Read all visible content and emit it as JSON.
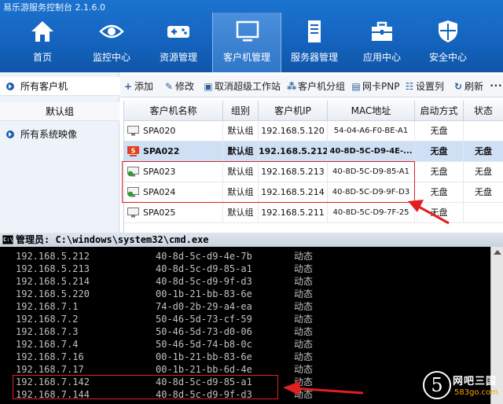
{
  "app": {
    "title": "易乐游服务控制台 2.1.6.0"
  },
  "nav": [
    {
      "label": "首页",
      "icon": "home-icon"
    },
    {
      "label": "监控中心",
      "icon": "eye-icon"
    },
    {
      "label": "资源管理",
      "icon": "gamepad-icon"
    },
    {
      "label": "客户机管理",
      "icon": "monitor-icon"
    },
    {
      "label": "服务器管理",
      "icon": "server-icon"
    },
    {
      "label": "应用中心",
      "icon": "toolbox-icon"
    },
    {
      "label": "安全中心",
      "icon": "shield-icon"
    }
  ],
  "sidebar": {
    "items": [
      {
        "label": "所有客户机"
      },
      {
        "label": "默认组"
      },
      {
        "label": "所有系统映像"
      }
    ]
  },
  "toolbar": {
    "buttons": [
      {
        "label": "添加",
        "icon": "plus-icon"
      },
      {
        "label": "修改",
        "icon": "edit-icon"
      },
      {
        "label": "取消超级工作站",
        "icon": "cancel-super-icon"
      },
      {
        "label": "客户机分组",
        "icon": "group-icon"
      },
      {
        "label": "网卡PNP",
        "icon": "nic-icon"
      },
      {
        "label": "设置列",
        "icon": "columns-icon"
      },
      {
        "label": "刷新",
        "icon": "refresh-icon"
      }
    ],
    "more": "•••"
  },
  "table": {
    "columns": [
      "客户机名称",
      "组别",
      "客户机IP",
      "MAC地址",
      "启动方式",
      "状态"
    ],
    "rows": [
      {
        "name": "SPA020",
        "group": "默认组",
        "ip": "192.168.5.120",
        "mac": "54-04-A6-F0-BE-A1",
        "boot": "无盘",
        "status": ""
      },
      {
        "name": "SPA022",
        "group": "默认组",
        "ip": "192.168.5.212",
        "mac": "40-8D-5C-D9-4E-...",
        "boot": "无盘",
        "status": "无盘"
      },
      {
        "name": "SPA023",
        "group": "默认组",
        "ip": "192.168.5.213",
        "mac": "40-8D-5C-D9-85-A1",
        "boot": "无盘",
        "status": "无盘"
      },
      {
        "name": "SPA024",
        "group": "默认组",
        "ip": "192.168.5.214",
        "mac": "40-8D-5C-D9-9F-D3",
        "boot": "无盘",
        "status": "无盘"
      },
      {
        "name": "SPA025",
        "group": "默认组",
        "ip": "192.168.5.211",
        "mac": "40-8D-5C-D9-7F-25",
        "boot": "无盘",
        "status": ""
      }
    ]
  },
  "cmd": {
    "title": "管理员: C:\\windows\\system32\\cmd.exe",
    "lines": [
      {
        "ip": "192.168.5.212",
        "mac": "40-8d-5c-d9-4e-7b",
        "type": "动态"
      },
      {
        "ip": "192.168.5.213",
        "mac": "40-8d-5c-d9-85-a1",
        "type": "动态"
      },
      {
        "ip": "192.168.5.214",
        "mac": "40-8d-5c-d9-9f-d3",
        "type": "动态"
      },
      {
        "ip": "192.168.5.220",
        "mac": "00-1b-21-bb-83-6e",
        "type": "动态"
      },
      {
        "ip": "192.168.7.1",
        "mac": "74-d0-2b-29-a4-ea",
        "type": "动态"
      },
      {
        "ip": "192.168.7.2",
        "mac": "50-46-5d-73-cf-59",
        "type": "动态"
      },
      {
        "ip": "192.168.7.3",
        "mac": "50-46-5d-73-d0-06",
        "type": "动态"
      },
      {
        "ip": "192.168.7.4",
        "mac": "50-46-5d-74-b8-0c",
        "type": "动态"
      },
      {
        "ip": "192.168.7.16",
        "mac": "00-1b-21-bb-83-6e",
        "type": "动态"
      },
      {
        "ip": "192.168.7.17",
        "mac": "00-1b-21-bb-6d-4e",
        "type": "动态"
      },
      {
        "ip": "192.168.7.142",
        "mac": "40-8d-5c-d9-85-a1",
        "type": "动态"
      },
      {
        "ip": "192.168.7.144",
        "mac": "40-8d-5c-d9-9f-d3",
        "type": "动态"
      }
    ]
  },
  "watermark": {
    "glyph": "5",
    "name": "网吧三国",
    "url": "583go.com"
  },
  "colors": {
    "header": "#1463bd",
    "selected_row": "#cfe0f5",
    "highlight": "#e02020"
  }
}
